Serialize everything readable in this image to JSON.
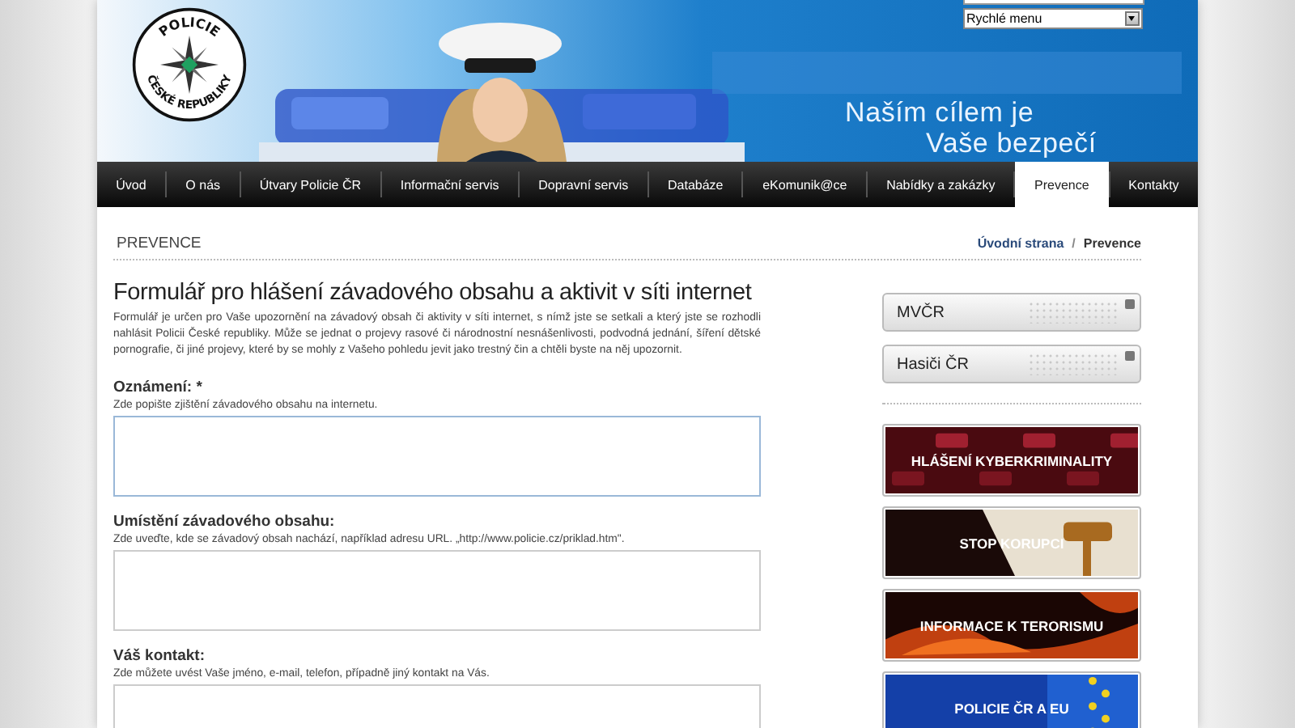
{
  "logo": {
    "top": "POLICIE",
    "bottom": "ČESKÉ REPUBLIKY"
  },
  "header": {
    "quick_menu": "Rychlé menu",
    "slogan": [
      "Naším cílem je",
      "Vaše bezpečí"
    ]
  },
  "nav": [
    {
      "label": "Úvod",
      "selected": false
    },
    {
      "label": "O nás",
      "selected": false
    },
    {
      "label": "Útvary Policie ČR",
      "selected": false
    },
    {
      "label": "Informační servis",
      "selected": false
    },
    {
      "label": "Dopravní servis",
      "selected": false
    },
    {
      "label": "Databáze",
      "selected": false
    },
    {
      "label": "eKomunik@ce",
      "selected": false
    },
    {
      "label": "Nabídky a zakázky",
      "selected": false
    },
    {
      "label": "Prevence",
      "selected": true
    },
    {
      "label": "Kontakty",
      "selected": false
    }
  ],
  "section_title": "PREVENCE",
  "breadcrumb": {
    "items": [
      "Úvodní strana",
      "Prevence"
    ],
    "separator": "/"
  },
  "form": {
    "title": "Formulář pro hlášení závadového obsahu a aktivit v síti internet",
    "intro": "Formulář je určen pro Vaše upozornění na závadový obsah či aktivity v síti internet, s nímž jste se setkali a který jste se rozhodli nahlásit Policii České republiky. Může se jednat o projevy rasové či národnostní nesnášenlivosti, podvodná jednání, šíření dětské pornografie, či jiné projevy, které by se mohly z Vašeho pohledu jevit jako trestný čin a chtěli byste na něj upozornit.",
    "fields": [
      {
        "label": "Oznámení: *",
        "hint": "Zde popište zjištění závadového obsahu na internetu.",
        "focused": true
      },
      {
        "label": "Umístění závadového obsahu:",
        "hint": "Zde uveďte, kde se závadový obsah nachází, například adresu URL. „http://www.policie.cz/priklad.htm\".",
        "focused": false
      },
      {
        "label": "Váš kontakt:",
        "hint": "Zde můžete uvést Vaše jméno, e-mail, telefon, případně jiný kontakt na Vás.",
        "focused": false
      }
    ]
  },
  "sidebar": {
    "links": [
      "MVČR",
      "Hasiči ČR"
    ],
    "banners": [
      {
        "label": "HLÁŠENÍ KYBERKRIMINALITY",
        "kind": "keyboard"
      },
      {
        "label": "STOP KORUPCI",
        "kind": "gavel"
      },
      {
        "label": "INFORMACE K TERORISMU",
        "kind": "fire"
      },
      {
        "label": "POLICIE ČR A EU",
        "kind": "flag"
      }
    ]
  }
}
